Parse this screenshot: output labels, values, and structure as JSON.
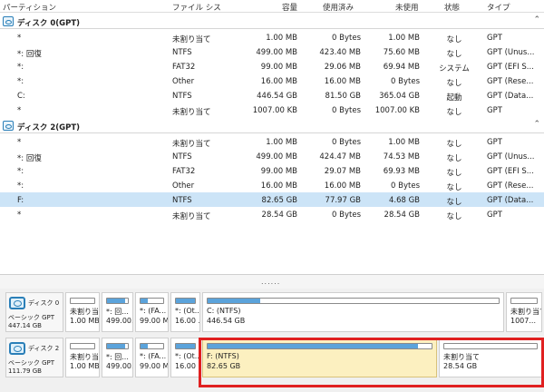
{
  "columns": {
    "partition": "パーティション",
    "filesystem": "ファイル シス",
    "capacity": "容量",
    "used": "使用済み",
    "free": "未使用",
    "status": "状態",
    "type": "タイプ"
  },
  "groups": [
    {
      "name": "ディスク 0(GPT)",
      "rows": [
        {
          "part": "*",
          "fs": "未割り当て",
          "cap": "1.00 MB",
          "used": "0 Bytes",
          "free": "1.00 MB",
          "status": "なし",
          "type": "GPT"
        },
        {
          "part": "*: 回復",
          "fs": "NTFS",
          "cap": "499.00 MB",
          "used": "423.40 MB",
          "free": "75.60 MB",
          "status": "なし",
          "type": "GPT (Unus..."
        },
        {
          "part": "*:",
          "fs": "FAT32",
          "cap": "99.00 MB",
          "used": "29.06 MB",
          "free": "69.94 MB",
          "status": "システム",
          "type": "GPT (EFI S..."
        },
        {
          "part": "*:",
          "fs": "Other",
          "cap": "16.00 MB",
          "used": "16.00 MB",
          "free": "0 Bytes",
          "status": "なし",
          "type": "GPT (Rese..."
        },
        {
          "part": "C:",
          "fs": "NTFS",
          "cap": "446.54 GB",
          "used": "81.50 GB",
          "free": "365.04 GB",
          "status": "起動",
          "type": "GPT (Data..."
        },
        {
          "part": "*",
          "fs": "未割り当て",
          "cap": "1007.00 KB",
          "used": "0 Bytes",
          "free": "1007.00 KB",
          "status": "なし",
          "type": "GPT"
        }
      ]
    },
    {
      "name": "ディスク 2(GPT)",
      "rows": [
        {
          "part": "*",
          "fs": "未割り当て",
          "cap": "1.00 MB",
          "used": "0 Bytes",
          "free": "1.00 MB",
          "status": "なし",
          "type": "GPT"
        },
        {
          "part": "*: 回復",
          "fs": "NTFS",
          "cap": "499.00 MB",
          "used": "424.47 MB",
          "free": "74.53 MB",
          "status": "なし",
          "type": "GPT (Unus..."
        },
        {
          "part": "*:",
          "fs": "FAT32",
          "cap": "99.00 MB",
          "used": "29.07 MB",
          "free": "69.93 MB",
          "status": "なし",
          "type": "GPT (EFI S..."
        },
        {
          "part": "*:",
          "fs": "Other",
          "cap": "16.00 MB",
          "used": "16.00 MB",
          "free": "0 Bytes",
          "status": "なし",
          "type": "GPT (Rese..."
        },
        {
          "part": "F:",
          "fs": "NTFS",
          "cap": "82.65 GB",
          "used": "77.97 GB",
          "free": "4.68 GB",
          "status": "なし",
          "type": "GPT (Data...",
          "selected": true
        },
        {
          "part": "*",
          "fs": "未割り当て",
          "cap": "28.54 GB",
          "used": "0 Bytes",
          "free": "28.54 GB",
          "status": "なし",
          "type": "GPT"
        }
      ]
    }
  ],
  "splitter_grip": "......",
  "disk_map": [
    {
      "name": "ディスク 0",
      "type": "ベーシック GPT",
      "size": "447.14 GB",
      "partitions": [
        {
          "label": "未割り当...",
          "size": "1.00 MB",
          "fill": 0
        },
        {
          "label": "*: 回...",
          "size": "499.00...",
          "fill": 0.85
        },
        {
          "label": "*: (FA...",
          "size": "99.00 M...",
          "fill": 0.3
        },
        {
          "label": "*: (Ot...",
          "size": "16.00 ...",
          "fill": 1
        },
        {
          "label": "C: (NTFS)",
          "size": "446.54 GB",
          "fill": 0.18
        },
        {
          "label": "未割り当て",
          "size": "1007...",
          "fill": 0
        }
      ]
    },
    {
      "name": "ディスク 2",
      "type": "ベーシック GPT",
      "size": "111.79 GB",
      "partitions": [
        {
          "label": "未割り当...",
          "size": "1.00 MB",
          "fill": 0
        },
        {
          "label": "*: 回...",
          "size": "499.00...",
          "fill": 0.85
        },
        {
          "label": "*: (FA...",
          "size": "99.00 M...",
          "fill": 0.3
        },
        {
          "label": "*: (Ot...",
          "size": "16.00 ...",
          "fill": 1
        },
        {
          "label": "F: (NTFS)",
          "size": "82.65 GB",
          "fill": 0.94,
          "selected": true
        },
        {
          "label": "未割り当て",
          "size": "28.54 GB",
          "fill": 0
        }
      ]
    }
  ],
  "colors": {
    "selection": "#cce4f7",
    "used_bar": "#5ba3db",
    "selected_partition": "#fcf0c0",
    "highlight_box": "#e02020"
  }
}
